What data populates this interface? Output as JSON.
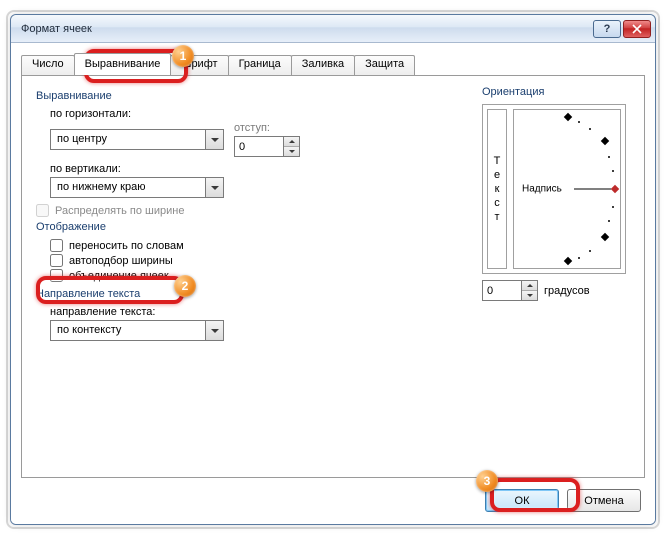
{
  "window": {
    "title": "Формат ячеек",
    "help_symbol": "?",
    "close_symbol": "✕"
  },
  "tabs": {
    "number": "Число",
    "alignment": "Выравнивание",
    "font": "Шрифт",
    "border": "Граница",
    "fill": "Заливка",
    "protection": "Защита"
  },
  "alignment": {
    "section": "Выравнивание",
    "horizontal_label": "по горизонтали:",
    "horizontal_value": "по центру",
    "indent_label": "отступ:",
    "indent_value": "0",
    "vertical_label": "по вертикали:",
    "vertical_value": "по нижнему краю",
    "distribute_label": "Распределять по ширине"
  },
  "display": {
    "section": "Отображение",
    "wrap": "переносить по словам",
    "shrink": "автоподбор ширины",
    "merge": "объединение ячеек"
  },
  "direction": {
    "section": "Направление текста",
    "label": "направление текста:",
    "value": "по контексту"
  },
  "orientation": {
    "section": "Ориентация",
    "vertical_text": "Текст",
    "angle_text": "Надпись",
    "degrees_value": "0",
    "degrees_label": "градусов"
  },
  "buttons": {
    "ok": "ОК",
    "cancel": "Отмена"
  },
  "callouts": {
    "b1": "1",
    "b2": "2",
    "b3": "3"
  }
}
